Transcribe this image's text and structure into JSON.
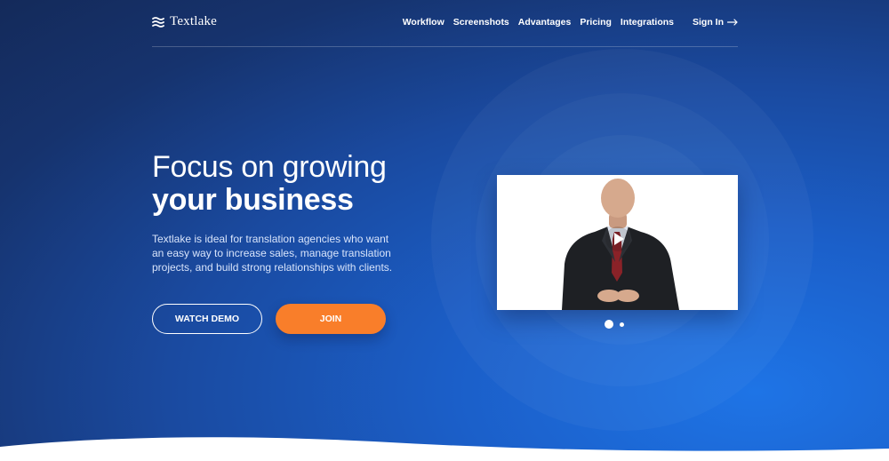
{
  "brand": {
    "name": "Textlake"
  },
  "nav": {
    "items": [
      {
        "label": "Workflow"
      },
      {
        "label": "Screenshots"
      },
      {
        "label": "Advantages"
      },
      {
        "label": "Pricing"
      },
      {
        "label": "Integrations"
      }
    ],
    "signin_label": "Sign In"
  },
  "hero": {
    "title_line1": "Focus on growing",
    "title_line2": "your business",
    "description": "Textlake is ideal for translation agencies who want an easy way to increase sales, manage translation projects, and build strong relationships with clients.",
    "watch_demo_label": "WATCH DEMO",
    "join_label": "JOIN"
  },
  "carousel": {
    "slide_count": 2,
    "active_slide": 1
  },
  "colors": {
    "background_dark": "#142a5a",
    "background_light": "#1e74e6",
    "accent_orange": "#f97e2a",
    "text_white": "#ffffff"
  },
  "icons": {
    "logo": "wave-lines-icon",
    "signin": "arrow-right-icon",
    "video": "play-icon"
  }
}
